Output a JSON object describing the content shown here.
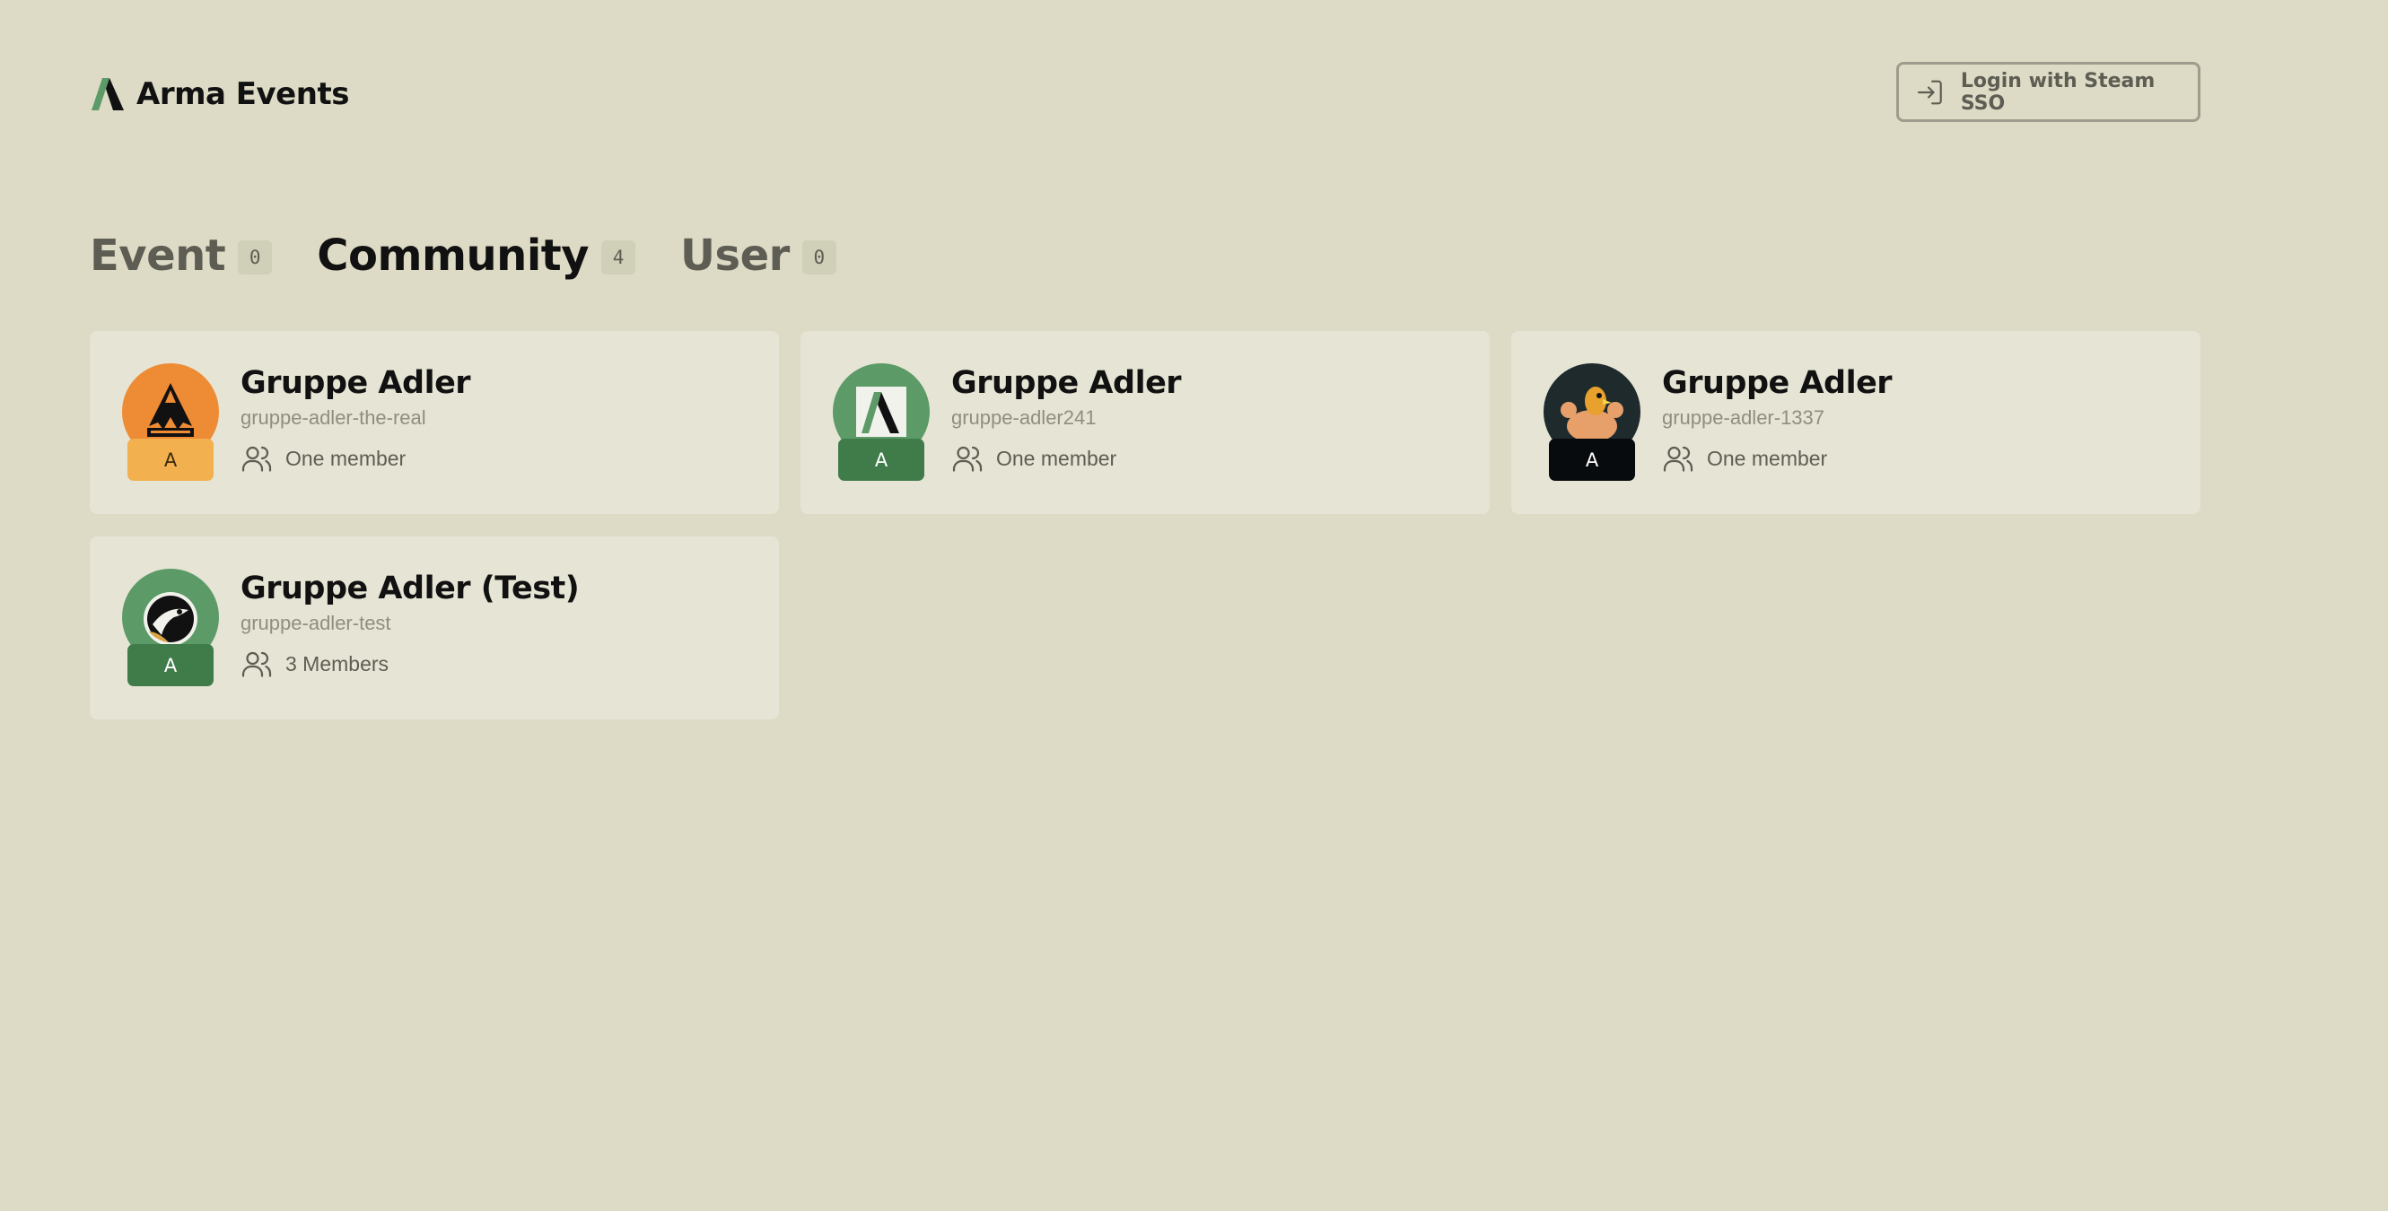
{
  "header": {
    "brand_title": "Arma Events",
    "login_label": "Login with Steam SSO"
  },
  "tabs": [
    {
      "label": "Event",
      "count": "0",
      "active": false
    },
    {
      "label": "Community",
      "count": "4",
      "active": true
    },
    {
      "label": "User",
      "count": "0",
      "active": false
    }
  ],
  "communities": [
    {
      "title": "Gruppe Adler",
      "slug": "gruppe-adler-the-real",
      "members": "One member",
      "badge": "A",
      "avatar_icon": "eagle-logo-orange-icon",
      "avatar_bg": "#ee8b35",
      "badge_bg": "#f3b04e",
      "badge_fg": "#3a2a10"
    },
    {
      "title": "Gruppe Adler",
      "slug": "gruppe-adler241",
      "members": "One member",
      "badge": "A",
      "avatar_icon": "arma-logo-icon",
      "avatar_bg": "#5c9a67",
      "badge_bg": "#3f7c4a",
      "badge_fg": "#ffffff"
    },
    {
      "title": "Gruppe Adler",
      "slug": "gruppe-adler-1337",
      "members": "One member",
      "badge": "A",
      "avatar_icon": "muscle-eagle-icon",
      "avatar_bg": "#1e2a2c",
      "badge_bg": "#070b0d",
      "badge_fg": "#ffffff"
    },
    {
      "title": "Gruppe Adler (Test)",
      "slug": "gruppe-adler-test",
      "members": "3 Members",
      "badge": "A",
      "avatar_icon": "eagle-head-icon",
      "avatar_bg": "#5c9a67",
      "badge_bg": "#3f7c4a",
      "badge_fg": "#ffffff"
    }
  ]
}
